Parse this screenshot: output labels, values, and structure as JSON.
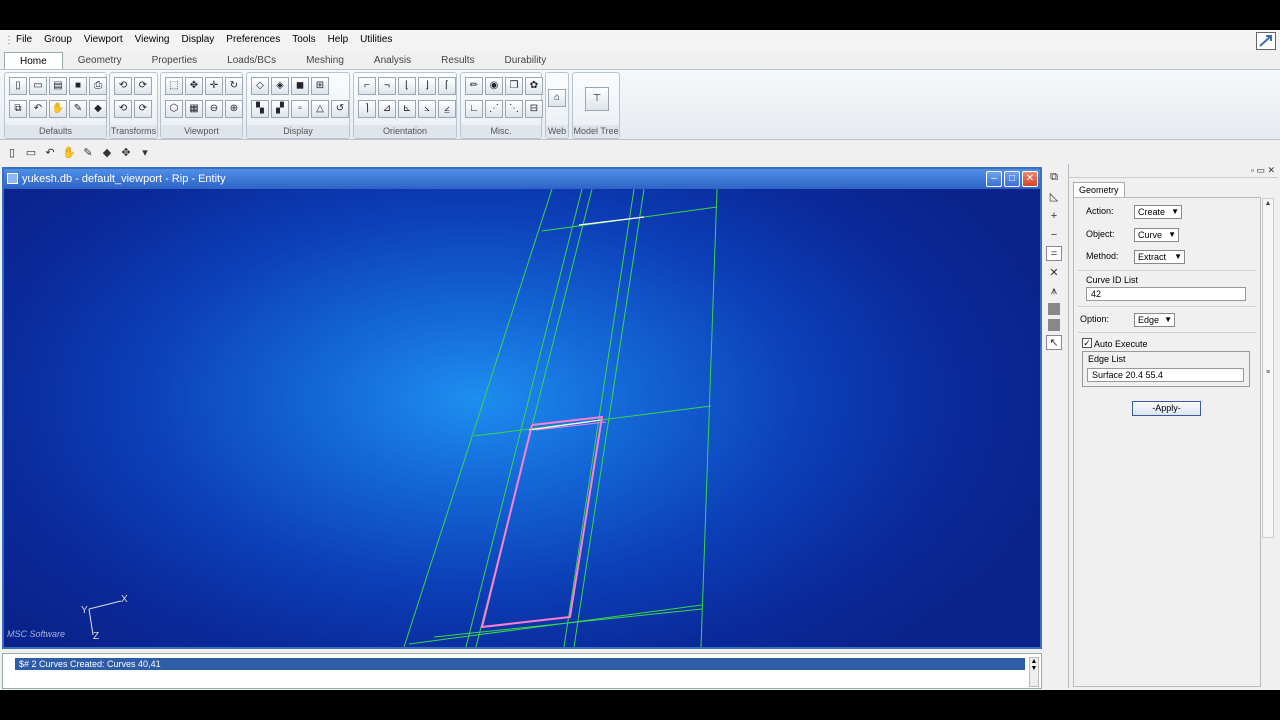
{
  "menu": [
    "File",
    "Group",
    "Viewport",
    "Viewing",
    "Display",
    "Preferences",
    "Tools",
    "Help",
    "Utilities"
  ],
  "ribbon_tabs": [
    "Home",
    "Geometry",
    "Properties",
    "Loads/BCs",
    "Meshing",
    "Analysis",
    "Results",
    "Durability"
  ],
  "ribbon_active_tab": "Home",
  "ribbon_groups": {
    "defaults": "Defaults",
    "transforms": "Transforms",
    "viewport": "Viewport",
    "display": "Display",
    "orientation": "Orientation",
    "misc": "Misc.",
    "web": "Web",
    "model_tree": "Model Tree"
  },
  "viewport": {
    "title": "yukesh.db - default_viewport - Rip - Entity",
    "axis_x": "X",
    "axis_y": "Y",
    "axis_z": "Z",
    "logo": "MSC Software",
    "colors": {
      "curves": "#39d64a",
      "highlight": "#ff7fd0",
      "selected": "#ffffff"
    }
  },
  "panel": {
    "tab": "Geometry",
    "action_label": "Action:",
    "action_value": "Create",
    "object_label": "Object:",
    "object_value": "Curve",
    "method_label": "Method:",
    "method_value": "Extract",
    "curve_id_label": "Curve ID List",
    "curve_id_value": "42",
    "option_label": "Option:",
    "option_value": "Edge",
    "auto_execute_label": "Auto Execute",
    "auto_execute_checked": true,
    "edge_list_label": "Edge List",
    "edge_list_value": "Surface 20.4 55.4",
    "apply_label": "-Apply-"
  },
  "command_output": "$# 2 Curves Created: Curves 40,41"
}
